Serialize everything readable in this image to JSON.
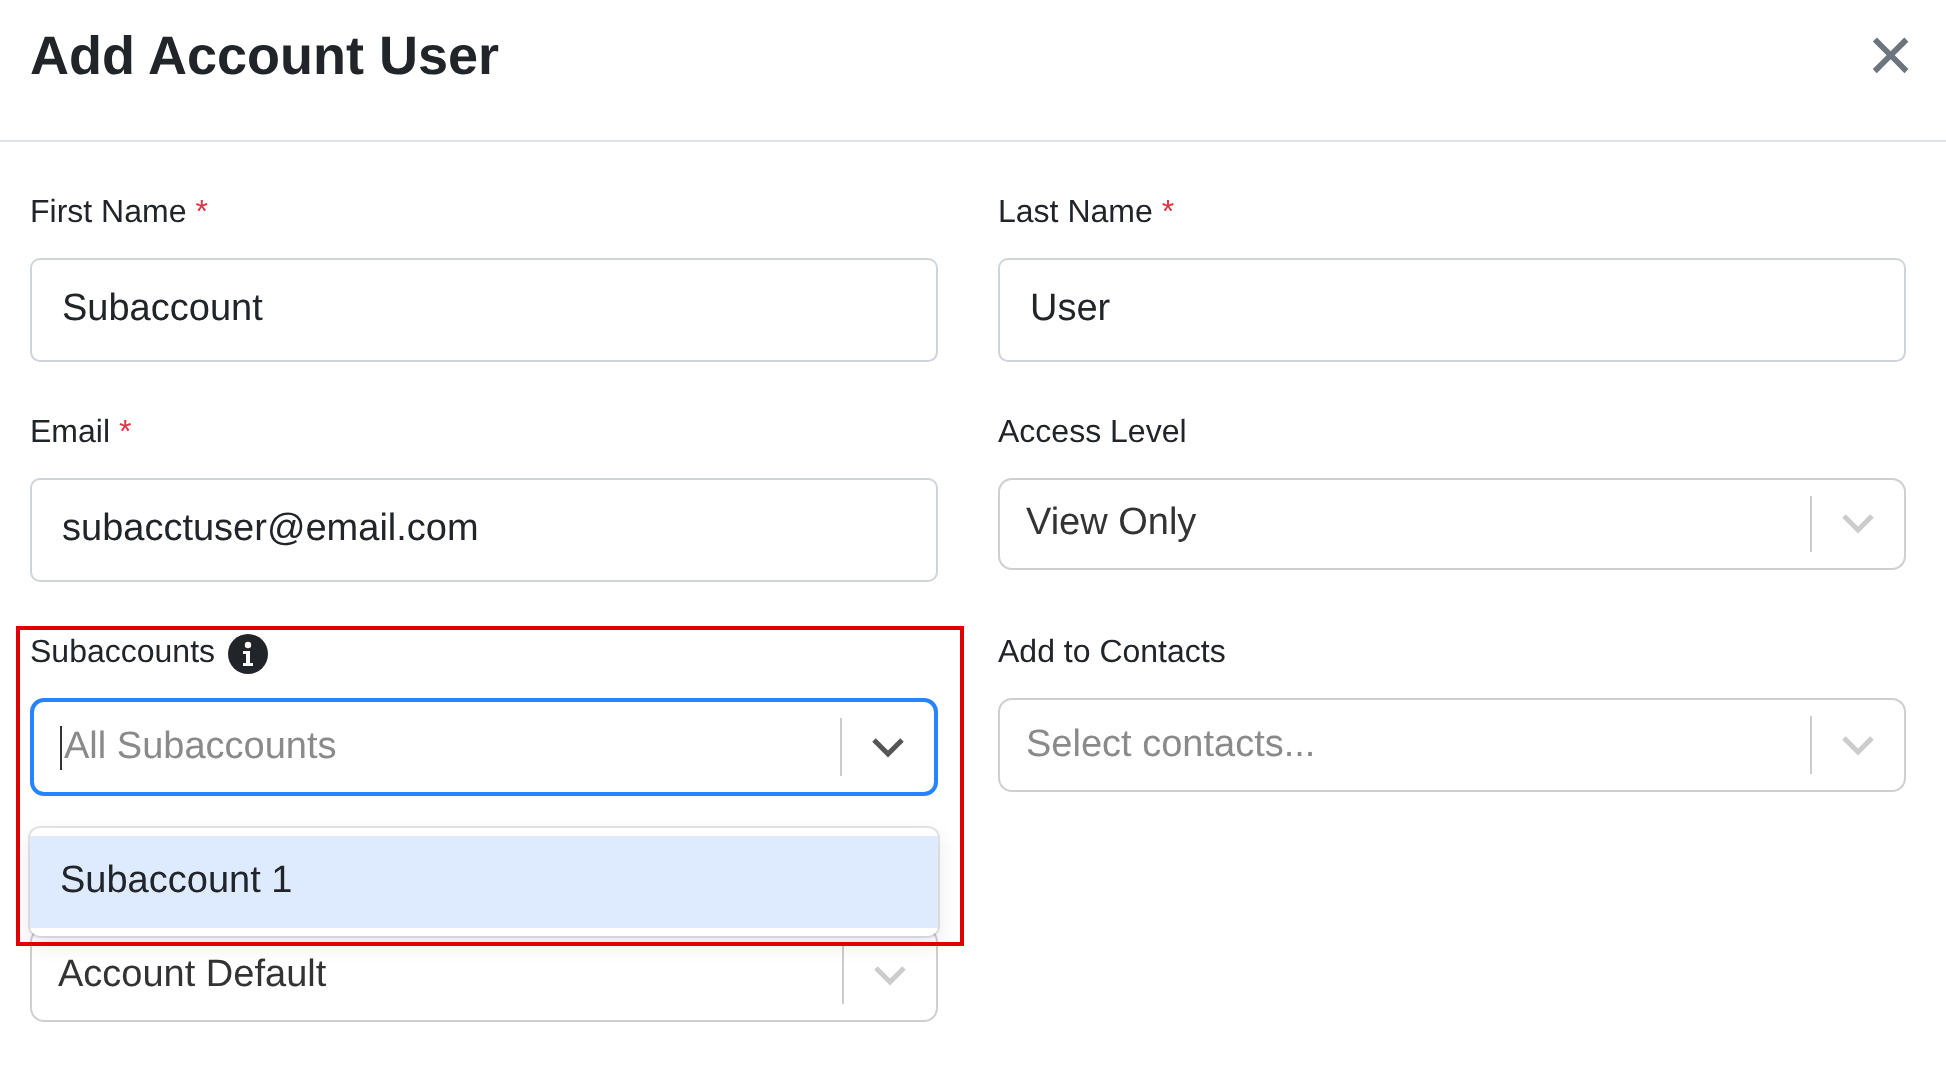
{
  "dialog": {
    "title": "Add Account User",
    "close": "×"
  },
  "fields": [
    {
      "kind": "input",
      "label": "First Name",
      "required_mark": "*",
      "value": "Subaccount"
    },
    {
      "kind": "input",
      "label": "Last Name",
      "required_mark": "*",
      "value": "User"
    },
    {
      "kind": "input",
      "label": "Email",
      "required_mark": "*",
      "value": "subacctuser@email.com"
    },
    {
      "kind": "select",
      "label": "Access Level",
      "value": "View Only",
      "focused": false
    },
    {
      "kind": "select",
      "label": "Subaccounts",
      "info": true,
      "placeholder": "All Subaccounts",
      "focused": true,
      "open": true,
      "options": [
        {
          "label": "Subaccount 1",
          "selected": true
        }
      ]
    },
    {
      "kind": "select",
      "label": "Add to Contacts",
      "placeholder": "Select contacts...",
      "focused": false
    },
    {
      "kind": "select",
      "value": "Account Default",
      "focused": false
    }
  ],
  "annotation": {
    "shown": true
  }
}
